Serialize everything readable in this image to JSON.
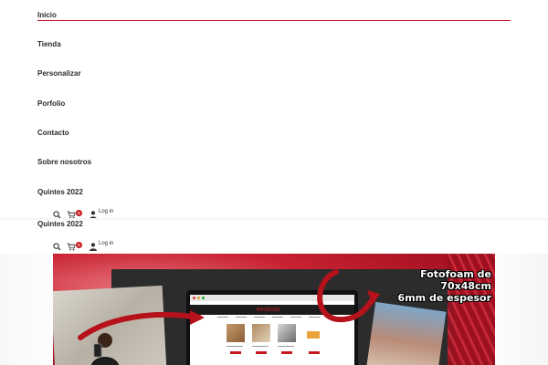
{
  "nav": {
    "items": [
      {
        "label": "Inicio"
      },
      {
        "label": "Tienda"
      },
      {
        "label": "Personalizar"
      },
      {
        "label": "Porfolio"
      },
      {
        "label": "Contacto"
      },
      {
        "label": "Sobre nosotros"
      },
      {
        "label": "Quintes 2022"
      }
    ],
    "duplicate_label": "Quintes 2022",
    "active_color": "#c4161c"
  },
  "icons": {
    "search": "search-icon",
    "cart": "cart-icon",
    "user": "user-icon"
  },
  "header_primary": {
    "cart_count": "0",
    "login_label": "Log in"
  },
  "header_secondary": {
    "cart_count": "0",
    "login_label": "Log in"
  },
  "banner": {
    "promo_line1": "Fotofoam de",
    "promo_line2": "70x48cm",
    "promo_line3": "6mm de espesor",
    "screen_logo": "exclusiu"
  }
}
